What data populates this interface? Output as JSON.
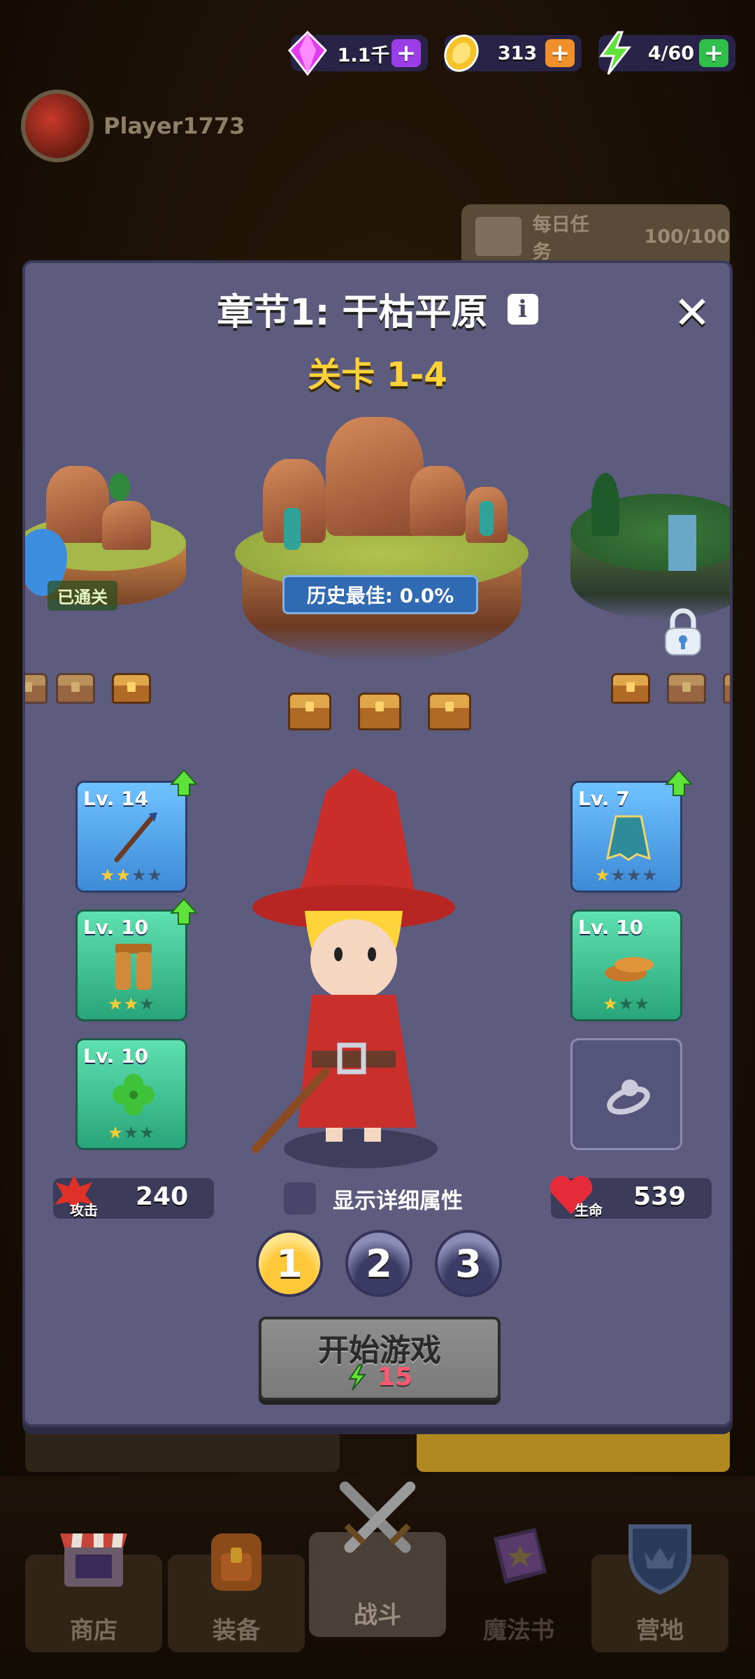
{
  "currencies": [
    {
      "name": "gems",
      "value": "1.1千",
      "plus_color": "#9b3ee8"
    },
    {
      "name": "coins",
      "value": "313",
      "plus_color": "#f0902a"
    },
    {
      "name": "energy",
      "value": "4/60",
      "plus_color": "#2fbf4a"
    }
  ],
  "player": {
    "name": "Player1773"
  },
  "daily_task": {
    "label": "每日任务",
    "progress": "100/100"
  },
  "stage": {
    "chapter_title": "章节1: 干枯平原",
    "info_icon": "i",
    "close_icon": "✕",
    "level_label": "关卡 1-4",
    "history_best": "历史最佳: 0.0%",
    "cleared_label": "已通关"
  },
  "equipment": {
    "left": [
      {
        "level": "Lv. 14",
        "item": "staff",
        "stars": 2,
        "max_stars": 4,
        "rarity": "blue",
        "upgrade": true
      },
      {
        "level": "Lv. 10",
        "item": "pants",
        "stars": 2,
        "max_stars": 3,
        "rarity": "green",
        "upgrade": true
      },
      {
        "level": "Lv. 10",
        "item": "clover",
        "stars": 1,
        "max_stars": 3,
        "rarity": "green",
        "upgrade": false
      }
    ],
    "right": [
      {
        "level": "Lv. 7",
        "item": "cloak",
        "stars": 1,
        "max_stars": 4,
        "rarity": "blue",
        "upgrade": true
      },
      {
        "level": "Lv. 10",
        "item": "shoes",
        "stars": 1,
        "max_stars": 3,
        "rarity": "green",
        "upgrade": false
      }
    ]
  },
  "stats": {
    "attack_value": "240",
    "attack_label": "攻击",
    "hp_value": "539",
    "hp_label": "生命",
    "detail_label": "显示详细属性"
  },
  "difficulty": [
    "1",
    "2",
    "3"
  ],
  "start": {
    "label": "开始游戏",
    "cost": "15"
  },
  "nav": [
    {
      "label": "商店",
      "icon": "shop-icon"
    },
    {
      "label": "装备",
      "icon": "backpack-icon"
    },
    {
      "label": "战斗",
      "icon": "crossed-swords-icon"
    },
    {
      "label": "魔法书",
      "icon": "spellbook-icon"
    },
    {
      "label": "营地",
      "icon": "crown-shield-icon"
    }
  ]
}
